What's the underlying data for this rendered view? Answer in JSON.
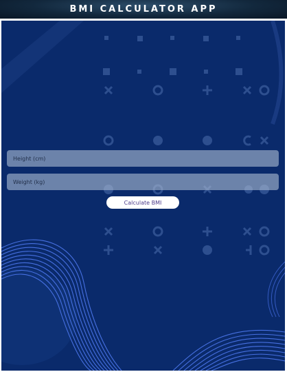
{
  "header": {
    "title": "BMI CALCULATOR APP"
  },
  "form": {
    "height_placeholder": "Height (cm)",
    "height_value": "",
    "weight_placeholder": "Weight (kg)",
    "weight_value": "",
    "calculate_label": "Calculate BMI"
  },
  "colors": {
    "background": "#0a2a6b",
    "accent_lines": "#4a74e8",
    "pattern": "#2e4f8f"
  }
}
